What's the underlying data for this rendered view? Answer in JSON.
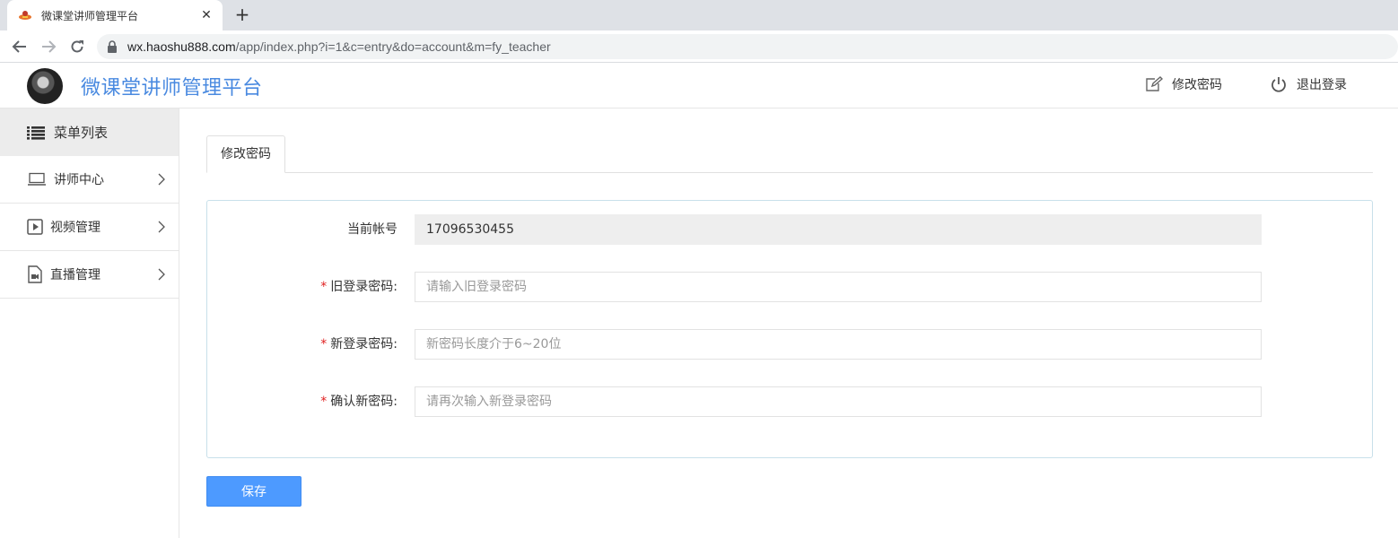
{
  "browser": {
    "tab_title": "微课堂讲师管理平台",
    "close_glyph": "✕",
    "new_tab_glyph": "+",
    "url_host": "wx.haoshu888.com",
    "url_path": "/app/index.php?i=1&c=entry&do=account&m=fy_teacher"
  },
  "header": {
    "title": "微课堂讲师管理平台",
    "change_password": "修改密码",
    "logout": "退出登录",
    "accent_color": "#4a8ae0"
  },
  "sidebar": {
    "heading": "菜单列表",
    "items": [
      {
        "label": "讲师中心",
        "icon": "laptop-icon"
      },
      {
        "label": "视频管理",
        "icon": "video-icon"
      },
      {
        "label": "直播管理",
        "icon": "live-icon"
      }
    ]
  },
  "main": {
    "tab_label": "修改密码",
    "form": {
      "account_label": "当前帐号",
      "account_value": "17096530455",
      "required_mark": "*",
      "old_password_label": "旧登录密码:",
      "old_password_placeholder": "请输入旧登录密码",
      "new_password_label": "新登录密码:",
      "new_password_placeholder": "新密码长度介于6~20位",
      "confirm_password_label": "确认新密码:",
      "confirm_password_placeholder": "请再次输入新登录密码"
    },
    "save_label": "保存"
  }
}
